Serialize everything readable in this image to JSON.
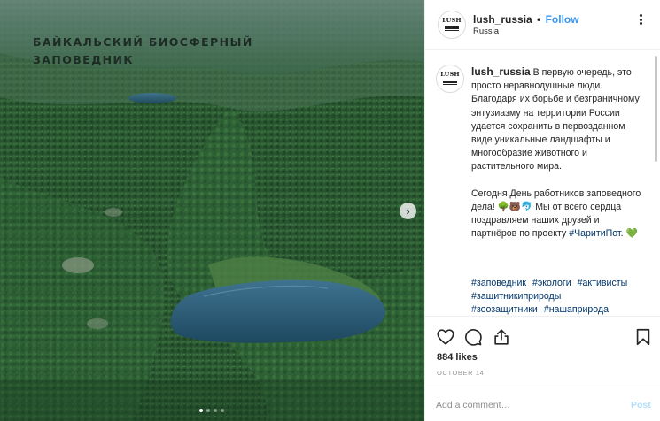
{
  "photo": {
    "caption_line1": "БАЙКАЛЬСКИЙ БИОСФЕРНЫЙ",
    "caption_line2": "ЗАПОВЕДНИК",
    "next_arrow": "›",
    "carousel_dots": 4,
    "active_dot": 1
  },
  "post": {
    "username": "lush_russia",
    "separator": "•",
    "follow_label": "Follow",
    "location": "Russia",
    "avatar_text": "LUSH",
    "caption": " В первую очередь, это просто неравнодушные люди. Благодаря их борьбе и безграничному энтузиазму на территории России удается сохранить в первозданном виде уникальные ландшафты и многообразие животного и растительного мира.\n\nСегодня День работников заповедного дела! 🌳🐻🐬 Мы от всего сердца поздравляем наших друзей и партнёров по проекту ",
    "caption_tag": "#ЧаритиПот",
    "caption_end": ". 💚",
    "hashtags": [
      "#заповедник",
      "#экологи",
      "#активисты",
      "#защитникиприроды",
      "#зоозащитники",
      "#нашаприрода"
    ],
    "likes": "884 likes",
    "date": "OCTOBER 14",
    "comment_placeholder": "Add a comment…",
    "post_label": "Post"
  },
  "icons": {
    "like": "heart-icon",
    "comment": "comment-icon",
    "share": "share-icon",
    "save": "bookmark-icon",
    "more": "more-options-icon"
  },
  "colors": {
    "link_blue": "#3897f0",
    "hashtag": "#003569",
    "post_disabled": "#b2dffc",
    "border": "#efefef"
  }
}
